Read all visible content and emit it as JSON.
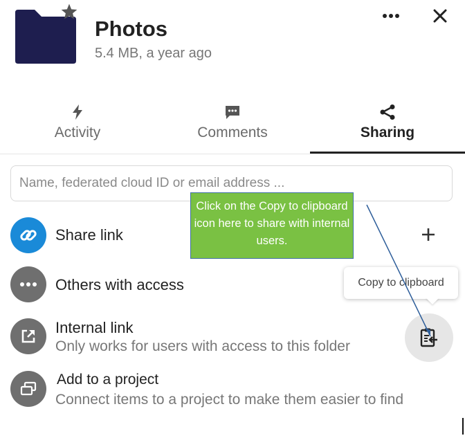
{
  "header": {
    "title": "Photos",
    "subtitle": "5.4 MB, a year ago",
    "folder_color": "#1e1e4f",
    "star_color": "#555555",
    "more_icon": "more-horizontal-icon",
    "close_icon": "close-icon"
  },
  "tabs": [
    {
      "label": "Activity",
      "icon": "lightning-icon"
    },
    {
      "label": "Comments",
      "icon": "comment-icon"
    },
    {
      "label": "Sharing",
      "icon": "share-icon",
      "active": true
    }
  ],
  "search": {
    "placeholder": "Name, federated cloud ID or email address ..."
  },
  "rows": {
    "share_link": {
      "title": "Share link",
      "icon": "link-icon",
      "action_icon": "plus-icon",
      "color": "#1a8ad8"
    },
    "others": {
      "title": "Others with access",
      "icon": "more-horizontal-icon"
    },
    "internal": {
      "title": "Internal link",
      "subtitle": "Only works for users with access to this folder",
      "icon": "external-link-icon",
      "action_icon": "clipboard-icon"
    },
    "project": {
      "title": "Add to a project",
      "subtitle": "Connect items to a project to make them easier to find",
      "icon": "project-icon"
    }
  },
  "tooltip": {
    "text": "Copy to clipboard"
  },
  "callout": {
    "text": "Click on the Copy to clipboard icon here to share with internal users.",
    "color": "#7ac143"
  }
}
